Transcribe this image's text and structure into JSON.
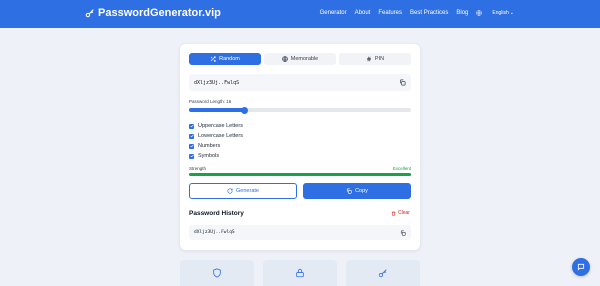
{
  "header": {
    "brand": "PasswordGenerator.vip",
    "nav": [
      "Generator",
      "About",
      "Features",
      "Best Practices",
      "Blog"
    ],
    "language": "English"
  },
  "tabs": [
    {
      "label": "Random",
      "icon": "shuffle-icon",
      "active": true
    },
    {
      "label": "Memorable",
      "icon": "globe-icon",
      "active": false
    },
    {
      "label": "PIN",
      "icon": "hash-icon",
      "active": false
    }
  ],
  "password": "dXljz3Uj..FwlqS",
  "length": {
    "label": "Password Length: 16",
    "value": 16,
    "fraction": 0.25
  },
  "options": [
    {
      "label": "Uppercase Letters",
      "checked": true
    },
    {
      "label": "Lowercase Letters",
      "checked": true
    },
    {
      "label": "Numbers",
      "checked": true
    },
    {
      "label": "Symbols",
      "checked": true
    }
  ],
  "strength": {
    "label": "Strength",
    "value": "Excellent",
    "fraction": 1.0,
    "color": "#16a34a"
  },
  "buttons": {
    "generate": "Generate",
    "copy": "Copy"
  },
  "history": {
    "title": "Password History",
    "clear": "Clear",
    "items": [
      "dXljz3Uj..FwlqS"
    ]
  },
  "feature_icons": [
    "shield-icon",
    "lock-icon",
    "key-icon"
  ],
  "colors": {
    "primary": "#2f6fe4",
    "success": "#16a34a",
    "danger": "#dc2626"
  }
}
